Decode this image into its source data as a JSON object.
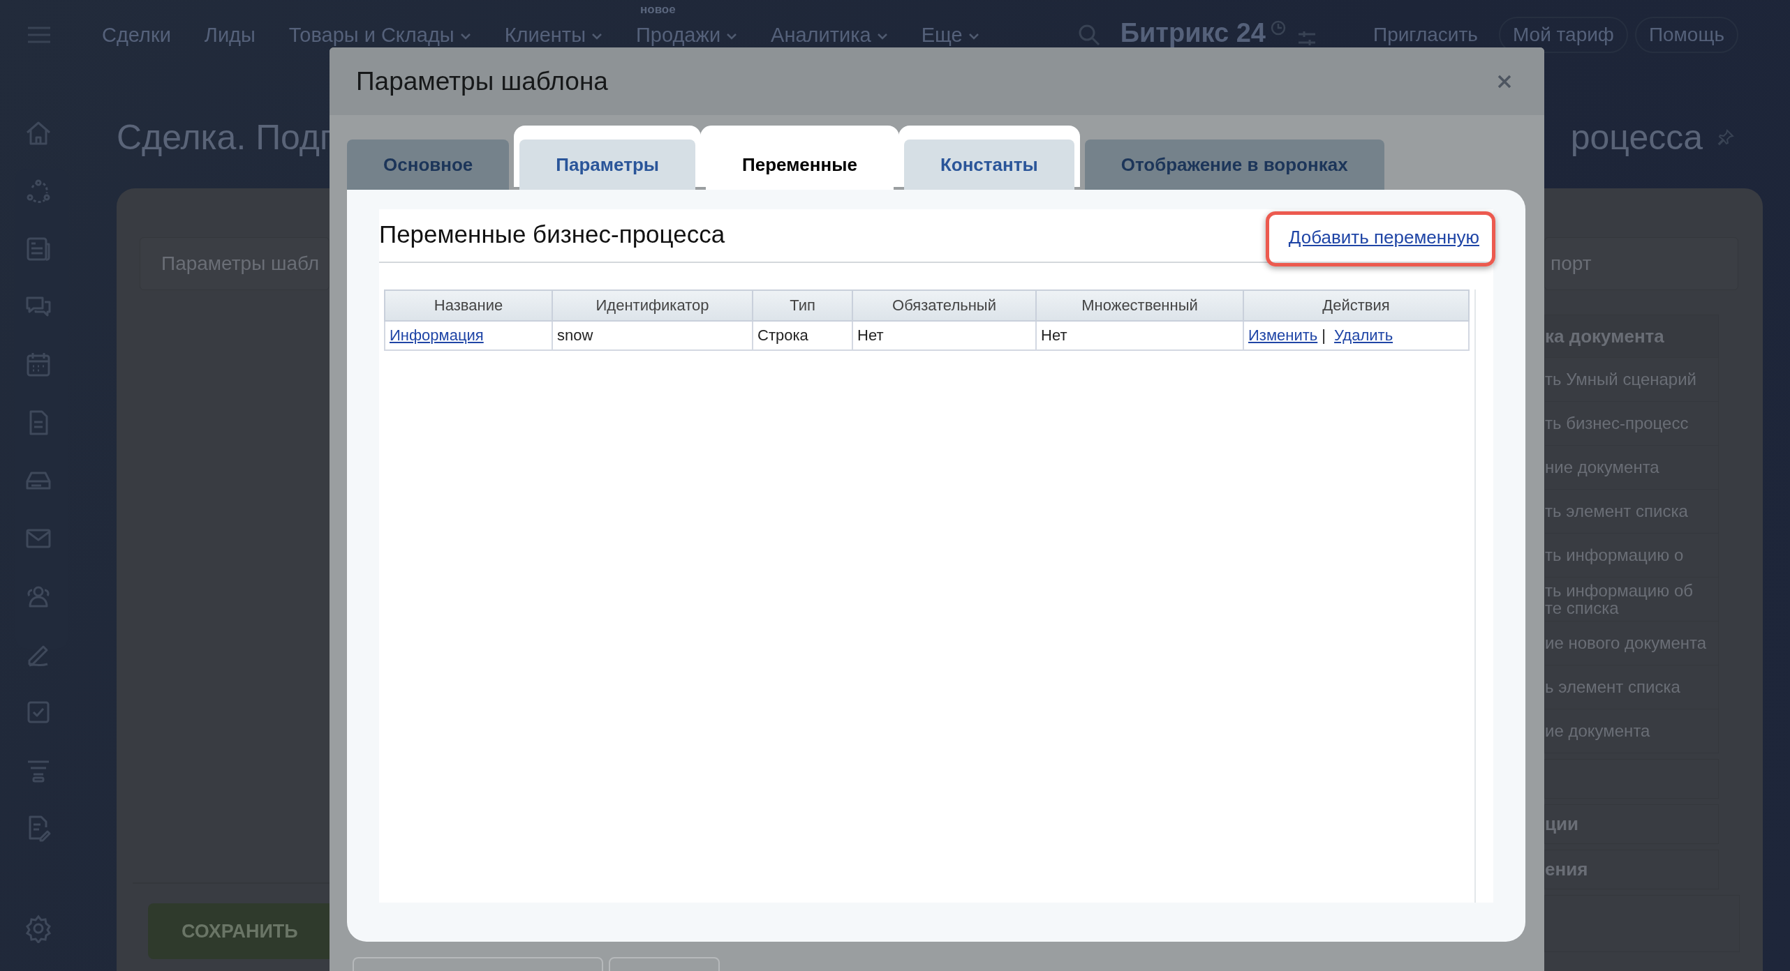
{
  "top_nav": {
    "items": [
      {
        "label": "Сделки",
        "dropdown": false
      },
      {
        "label": "Лиды",
        "dropdown": false
      },
      {
        "label": "Товары и Склады",
        "dropdown": true
      },
      {
        "label": "Клиенты",
        "dropdown": true
      },
      {
        "label": "Продажи",
        "dropdown": true,
        "badge": "новое"
      },
      {
        "label": "Аналитика",
        "dropdown": true
      },
      {
        "label": "Еще",
        "dropdown": true
      }
    ],
    "logo": "Битрикс 24",
    "buttons": [
      "Пригласить",
      "Мой тариф",
      "Помощь"
    ]
  },
  "page": {
    "title_start": "Сделка. Подг",
    "title_end": "роцесса",
    "template_field": "Параметры шабл",
    "right_field": "порт",
    "right_panel": {
      "header": "ка документа",
      "items": [
        "ть Умный сценарий",
        "ть бизнес-процесс",
        "ние документа",
        "ть элемент списка",
        "ть информацию о",
        "ть информацию об\nте списка",
        "ие нового документа",
        "ь элемент списка",
        "ие документа"
      ]
    },
    "sections": [
      "ции",
      "ения"
    ],
    "save_button": "СОХРАНИТЬ"
  },
  "modal": {
    "title": "Параметры шаблона",
    "tabs": [
      {
        "label": "Основное",
        "selected": false,
        "highlighted": false
      },
      {
        "label": "Параметры",
        "selected": false,
        "highlighted": true
      },
      {
        "label": "Переменные",
        "selected": true,
        "highlighted": true
      },
      {
        "label": "Константы",
        "selected": false,
        "highlighted": true
      },
      {
        "label": "Отображение в воронках",
        "selected": false,
        "highlighted": false
      }
    ],
    "section_title": "Переменные бизнес-процесса",
    "add_link": {
      "label": "Добавить переменную",
      "highlighted": true
    },
    "table": {
      "columns": [
        "Название",
        "Идентификатор",
        "Тип",
        "Обязательный",
        "Множественный",
        "Действия"
      ],
      "rows": [
        {
          "cells": [
            {
              "kind": "link",
              "text": "Информация"
            },
            {
              "kind": "text",
              "text": "snow"
            },
            {
              "kind": "text",
              "text": "Строка"
            },
            {
              "kind": "text",
              "text": "Нет"
            },
            {
              "kind": "text",
              "text": "Нет"
            },
            {
              "kind": "actions",
              "links": [
                "Изменить",
                "Удалить"
              ],
              "separator": "|"
            }
          ]
        }
      ]
    }
  }
}
